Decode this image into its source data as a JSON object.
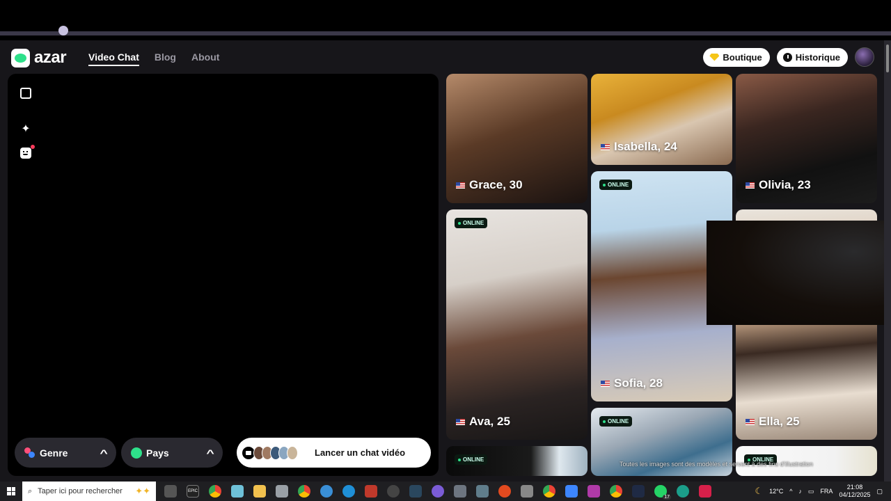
{
  "header": {
    "logo_text": "azar",
    "nav": [
      {
        "label": "Video Chat",
        "active": true
      },
      {
        "label": "Blog",
        "active": false
      },
      {
        "label": "About",
        "active": false
      }
    ],
    "boutique_label": "Boutique",
    "historique_label": "Historique"
  },
  "video_panel": {
    "tools": [
      "expand-icon",
      "sparkle-icon",
      "face-icon"
    ],
    "genre_label": "Genre",
    "pays_label": "Pays",
    "launch_label": "Lancer un chat vidéo"
  },
  "profiles": {
    "online_label": "ONLINE",
    "grace": "Grace, 30",
    "isabella": "Isabella, 24",
    "olivia": "Olivia, 23",
    "ava": "Ava, 25",
    "sofia": "Sofia, 28",
    "ella": "Ella, 25"
  },
  "disclaimer": "Toutes les images sont des modèles et servent à des fins d'illustration",
  "taskbar": {
    "search_placeholder": "Taper ici pour rechercher",
    "epic_label": "EPIC",
    "weather": "12°C",
    "language": "FRA",
    "time": "21:08",
    "date": "04/12/2025",
    "whatsapp_badge": "17"
  },
  "colors": {
    "accent": "#2ee08a",
    "background": "#17161a",
    "online_dot": "#2ee08a"
  }
}
